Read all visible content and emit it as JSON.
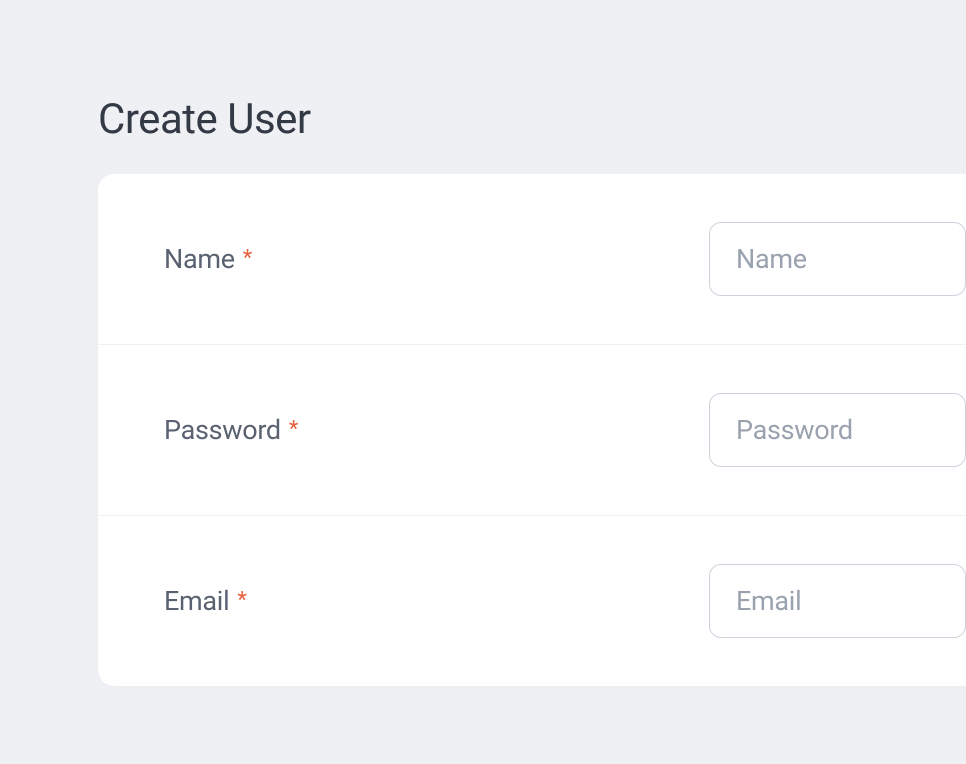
{
  "page": {
    "title": "Create User"
  },
  "form": {
    "fields": [
      {
        "label": "Name",
        "required": true,
        "placeholder": "Name",
        "value": ""
      },
      {
        "label": "Password",
        "required": true,
        "placeholder": "Password",
        "value": ""
      },
      {
        "label": "Email",
        "required": true,
        "placeholder": "Email",
        "value": ""
      }
    ],
    "required_marker": "*"
  }
}
